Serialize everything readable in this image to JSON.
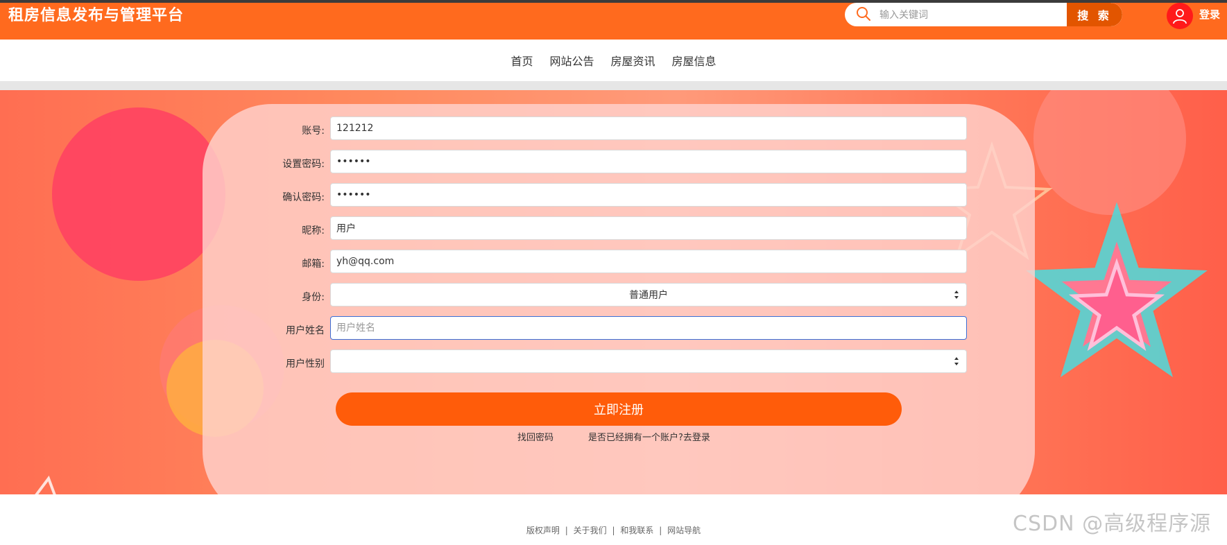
{
  "header": {
    "site_title": "租房信息发布与管理平台",
    "search_placeholder": "输入关键词",
    "search_button": "搜 索",
    "login_label": "登录"
  },
  "nav": {
    "items": [
      "首页",
      "网站公告",
      "房屋资讯",
      "房屋信息"
    ]
  },
  "form": {
    "fields": [
      {
        "label": "账号:",
        "value": "121212",
        "type": "text"
      },
      {
        "label": "设置密码:",
        "value": "••••••",
        "type": "password"
      },
      {
        "label": "确认密码:",
        "value": "••••••",
        "type": "password"
      },
      {
        "label": "昵称:",
        "value": "用户",
        "type": "text"
      },
      {
        "label": "邮箱:",
        "value": "yh@qq.com",
        "type": "text"
      },
      {
        "label": "身份:",
        "value": "普通用户",
        "type": "select"
      },
      {
        "label": "用户姓名",
        "value": "",
        "placeholder": "用户姓名",
        "type": "text"
      },
      {
        "label": "用户性别",
        "value": "",
        "type": "select"
      }
    ],
    "submit_label": "立即注册",
    "forgot_password": "找回密码",
    "have_account": "是否已经拥有一个账户?去登录"
  },
  "footer": {
    "links": [
      "版权声明",
      "关于我们",
      "和我联系",
      "网站导航"
    ],
    "separator": "|"
  },
  "watermark": "CSDN @高级程序源",
  "colors": {
    "brand_orange": "#ff6a1e",
    "button_orange": "#ff5c0a",
    "avatar_red": "#ff1a1a",
    "focus_blue": "#3a6fd8"
  }
}
